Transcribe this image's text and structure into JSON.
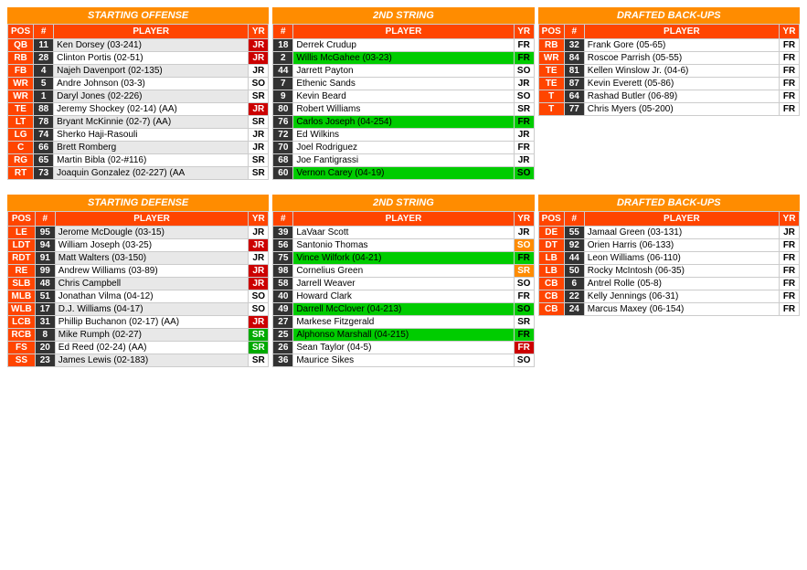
{
  "offense": {
    "title": "STARTING OFFENSE",
    "headers": [
      "POS",
      "#",
      "PLAYER",
      "YR"
    ],
    "rows": [
      {
        "pos": "QB",
        "num": "11",
        "player": "Ken Dorsey (03-241)",
        "yr": "JR",
        "highlight": false,
        "yr_class": "yr-red"
      },
      {
        "pos": "RB",
        "num": "28",
        "player": "Clinton Portis (02-51)",
        "yr": "JR",
        "highlight": false,
        "yr_class": "yr-red"
      },
      {
        "pos": "FB",
        "num": "4",
        "player": "Najeh Davenport (02-135)",
        "yr": "JR",
        "highlight": false,
        "yr_class": ""
      },
      {
        "pos": "WR",
        "num": "5",
        "player": "Andre Johnson (03-3)",
        "yr": "SO",
        "highlight": false,
        "yr_class": ""
      },
      {
        "pos": "WR",
        "num": "1",
        "player": "Daryl Jones (02-226)",
        "yr": "SR",
        "highlight": false,
        "yr_class": ""
      },
      {
        "pos": "TE",
        "num": "88",
        "player": "Jeremy Shockey (02-14) (AA)",
        "yr": "JR",
        "highlight": false,
        "yr_class": "yr-red"
      },
      {
        "pos": "LT",
        "num": "78",
        "player": "Bryant McKinnie (02-7) (AA)",
        "yr": "SR",
        "highlight": false,
        "yr_class": ""
      },
      {
        "pos": "LG",
        "num": "74",
        "player": "Sherko Haji-Rasouli",
        "yr": "JR",
        "highlight": false,
        "yr_class": ""
      },
      {
        "pos": "C",
        "num": "66",
        "player": "Brett Romberg",
        "yr": "JR",
        "highlight": false,
        "yr_class": ""
      },
      {
        "pos": "RG",
        "num": "65",
        "player": "Martin Bibla (02-#116)",
        "yr": "SR",
        "highlight": false,
        "yr_class": ""
      },
      {
        "pos": "RT",
        "num": "73",
        "player": "Joaquin Gonzalez (02-227) (AA",
        "yr": "SR",
        "highlight": false,
        "yr_class": ""
      }
    ]
  },
  "offense2nd": {
    "title": "2ND STRING",
    "headers": [
      "#",
      "PLAYER",
      "YR"
    ],
    "rows": [
      {
        "num": "18",
        "player": "Derrek Crudup",
        "yr": "FR",
        "highlight": false,
        "yr_class": ""
      },
      {
        "num": "2",
        "player": "Willis McGahee (03-23)",
        "yr": "FR",
        "highlight": true,
        "yr_class": ""
      },
      {
        "num": "44",
        "player": "Jarrett Payton",
        "yr": "SO",
        "highlight": false,
        "yr_class": ""
      },
      {
        "num": "7",
        "player": "Ethenic Sands",
        "yr": "JR",
        "highlight": false,
        "yr_class": ""
      },
      {
        "num": "9",
        "player": "Kevin Beard",
        "yr": "SO",
        "highlight": false,
        "yr_class": ""
      },
      {
        "num": "80",
        "player": "Robert Williams",
        "yr": "SR",
        "highlight": false,
        "yr_class": ""
      },
      {
        "num": "76",
        "player": "Carlos Joseph (04-254)",
        "yr": "FR",
        "highlight": true,
        "yr_class": ""
      },
      {
        "num": "72",
        "player": "Ed Wilkins",
        "yr": "JR",
        "highlight": false,
        "yr_class": ""
      },
      {
        "num": "70",
        "player": "Joel Rodriguez",
        "yr": "FR",
        "highlight": false,
        "yr_class": ""
      },
      {
        "num": "68",
        "player": "Joe Fantigrassi",
        "yr": "JR",
        "highlight": false,
        "yr_class": ""
      },
      {
        "num": "60",
        "player": "Vernon Carey (04-19)",
        "yr": "SO",
        "highlight": true,
        "yr_class": ""
      }
    ]
  },
  "offenseDrafted": {
    "title": "DRAFTED BACK-UPS",
    "headers": [
      "POS",
      "#",
      "PLAYER",
      "YR"
    ],
    "rows": [
      {
        "pos": "RB",
        "num": "32",
        "player": "Frank Gore (05-65)",
        "yr": "FR",
        "highlight": false
      },
      {
        "pos": "WR",
        "num": "84",
        "player": "Roscoe Parrish (05-55)",
        "yr": "FR",
        "highlight": false
      },
      {
        "pos": "TE",
        "num": "81",
        "player": "Kellen Winslow Jr. (04-6)",
        "yr": "FR",
        "highlight": false
      },
      {
        "pos": "TE",
        "num": "87",
        "player": "Kevin Everett (05-86)",
        "yr": "FR",
        "highlight": false
      },
      {
        "pos": "T",
        "num": "64",
        "player": "Rashad Butler (06-89)",
        "yr": "FR",
        "highlight": false
      },
      {
        "pos": "T",
        "num": "77",
        "player": "Chris Myers (05-200)",
        "yr": "FR",
        "highlight": false
      }
    ]
  },
  "defense": {
    "title": "STARTING DEFENSE",
    "headers": [
      "POS",
      "#",
      "PLAYER",
      "YR"
    ],
    "rows": [
      {
        "pos": "LE",
        "num": "95",
        "player": "Jerome McDougle (03-15)",
        "yr": "JR",
        "highlight": false,
        "yr_class": ""
      },
      {
        "pos": "LDT",
        "num": "94",
        "player": "William Joseph (03-25)",
        "yr": "JR",
        "highlight": false,
        "yr_class": "yr-red"
      },
      {
        "pos": "RDT",
        "num": "91",
        "player": "Matt Walters (03-150)",
        "yr": "JR",
        "highlight": false,
        "yr_class": ""
      },
      {
        "pos": "RE",
        "num": "99",
        "player": "Andrew Williams (03-89)",
        "yr": "JR",
        "highlight": false,
        "yr_class": "yr-red"
      },
      {
        "pos": "SLB",
        "num": "48",
        "player": "Chris Campbell",
        "yr": "JR",
        "highlight": false,
        "yr_class": "yr-red"
      },
      {
        "pos": "MLB",
        "num": "51",
        "player": "Jonathan Vilma (04-12)",
        "yr": "SO",
        "highlight": false,
        "yr_class": ""
      },
      {
        "pos": "WLB",
        "num": "17",
        "player": "D.J. Williams (04-17)",
        "yr": "SO",
        "highlight": false,
        "yr_class": ""
      },
      {
        "pos": "LCB",
        "num": "31",
        "player": "Phillip Buchanon (02-17) (AA)",
        "yr": "JR",
        "highlight": false,
        "yr_class": "yr-red"
      },
      {
        "pos": "RCB",
        "num": "8",
        "player": "Mike Rumph (02-27)",
        "yr": "SR",
        "highlight": false,
        "yr_class": "yr-green"
      },
      {
        "pos": "FS",
        "num": "20",
        "player": "Ed Reed (02-24) (AA)",
        "yr": "SR",
        "highlight": false,
        "yr_class": "yr-green"
      },
      {
        "pos": "SS",
        "num": "23",
        "player": "James Lewis (02-183)",
        "yr": "SR",
        "highlight": false,
        "yr_class": ""
      }
    ]
  },
  "defense2nd": {
    "title": "2ND STRING",
    "headers": [
      "#",
      "PLAYER",
      "YR"
    ],
    "rows": [
      {
        "num": "39",
        "player": "LaVaar Scott",
        "yr": "JR",
        "highlight": false,
        "yr_class": ""
      },
      {
        "num": "56",
        "player": "Santonio Thomas",
        "yr": "SO",
        "highlight": false,
        "yr_class": "yr-orange"
      },
      {
        "num": "75",
        "player": "Vince Wilfork (04-21)",
        "yr": "FR",
        "highlight": true,
        "yr_class": ""
      },
      {
        "num": "98",
        "player": "Cornelius Green",
        "yr": "SR",
        "highlight": false,
        "yr_class": "yr-orange"
      },
      {
        "num": "58",
        "player": "Jarrell Weaver",
        "yr": "SO",
        "highlight": false,
        "yr_class": ""
      },
      {
        "num": "40",
        "player": "Howard Clark",
        "yr": "FR",
        "highlight": false,
        "yr_class": ""
      },
      {
        "num": "49",
        "player": "Darrell McClover (04-213)",
        "yr": "SO",
        "highlight": true,
        "yr_class": ""
      },
      {
        "num": "27",
        "player": "Markese Fitzgerald",
        "yr": "SR",
        "highlight": false,
        "yr_class": ""
      },
      {
        "num": "25",
        "player": "Alphonso Marshall (04-215)",
        "yr": "FR",
        "highlight": true,
        "yr_class": ""
      },
      {
        "num": "26",
        "player": "Sean Taylor (04-5)",
        "yr": "FR",
        "highlight": false,
        "yr_class": "yr-red"
      },
      {
        "num": "36",
        "player": "Maurice Sikes",
        "yr": "SO",
        "highlight": false,
        "yr_class": ""
      }
    ]
  },
  "defenseDrafted": {
    "title": "DRAFTED BACK-UPS",
    "headers": [
      "POS",
      "#",
      "PLAYER",
      "YR"
    ],
    "rows": [
      {
        "pos": "DE",
        "num": "55",
        "player": "Jamaal Green (03-131)",
        "yr": "JR",
        "highlight": false
      },
      {
        "pos": "DT",
        "num": "92",
        "player": "Orien Harris (06-133)",
        "yr": "FR",
        "highlight": false
      },
      {
        "pos": "LB",
        "num": "44",
        "player": "Leon Williams (06-110)",
        "yr": "FR",
        "highlight": false
      },
      {
        "pos": "LB",
        "num": "50",
        "player": "Rocky McIntosh (06-35)",
        "yr": "FR",
        "highlight": false
      },
      {
        "pos": "CB",
        "num": "6",
        "player": "Antrel Rolle (05-8)",
        "yr": "FR",
        "highlight": false
      },
      {
        "pos": "CB",
        "num": "22",
        "player": "Kelly Jennings (06-31)",
        "yr": "FR",
        "highlight": false
      },
      {
        "pos": "CB",
        "num": "24",
        "player": "Marcus Maxey (06-154)",
        "yr": "FR",
        "highlight": false
      }
    ]
  }
}
